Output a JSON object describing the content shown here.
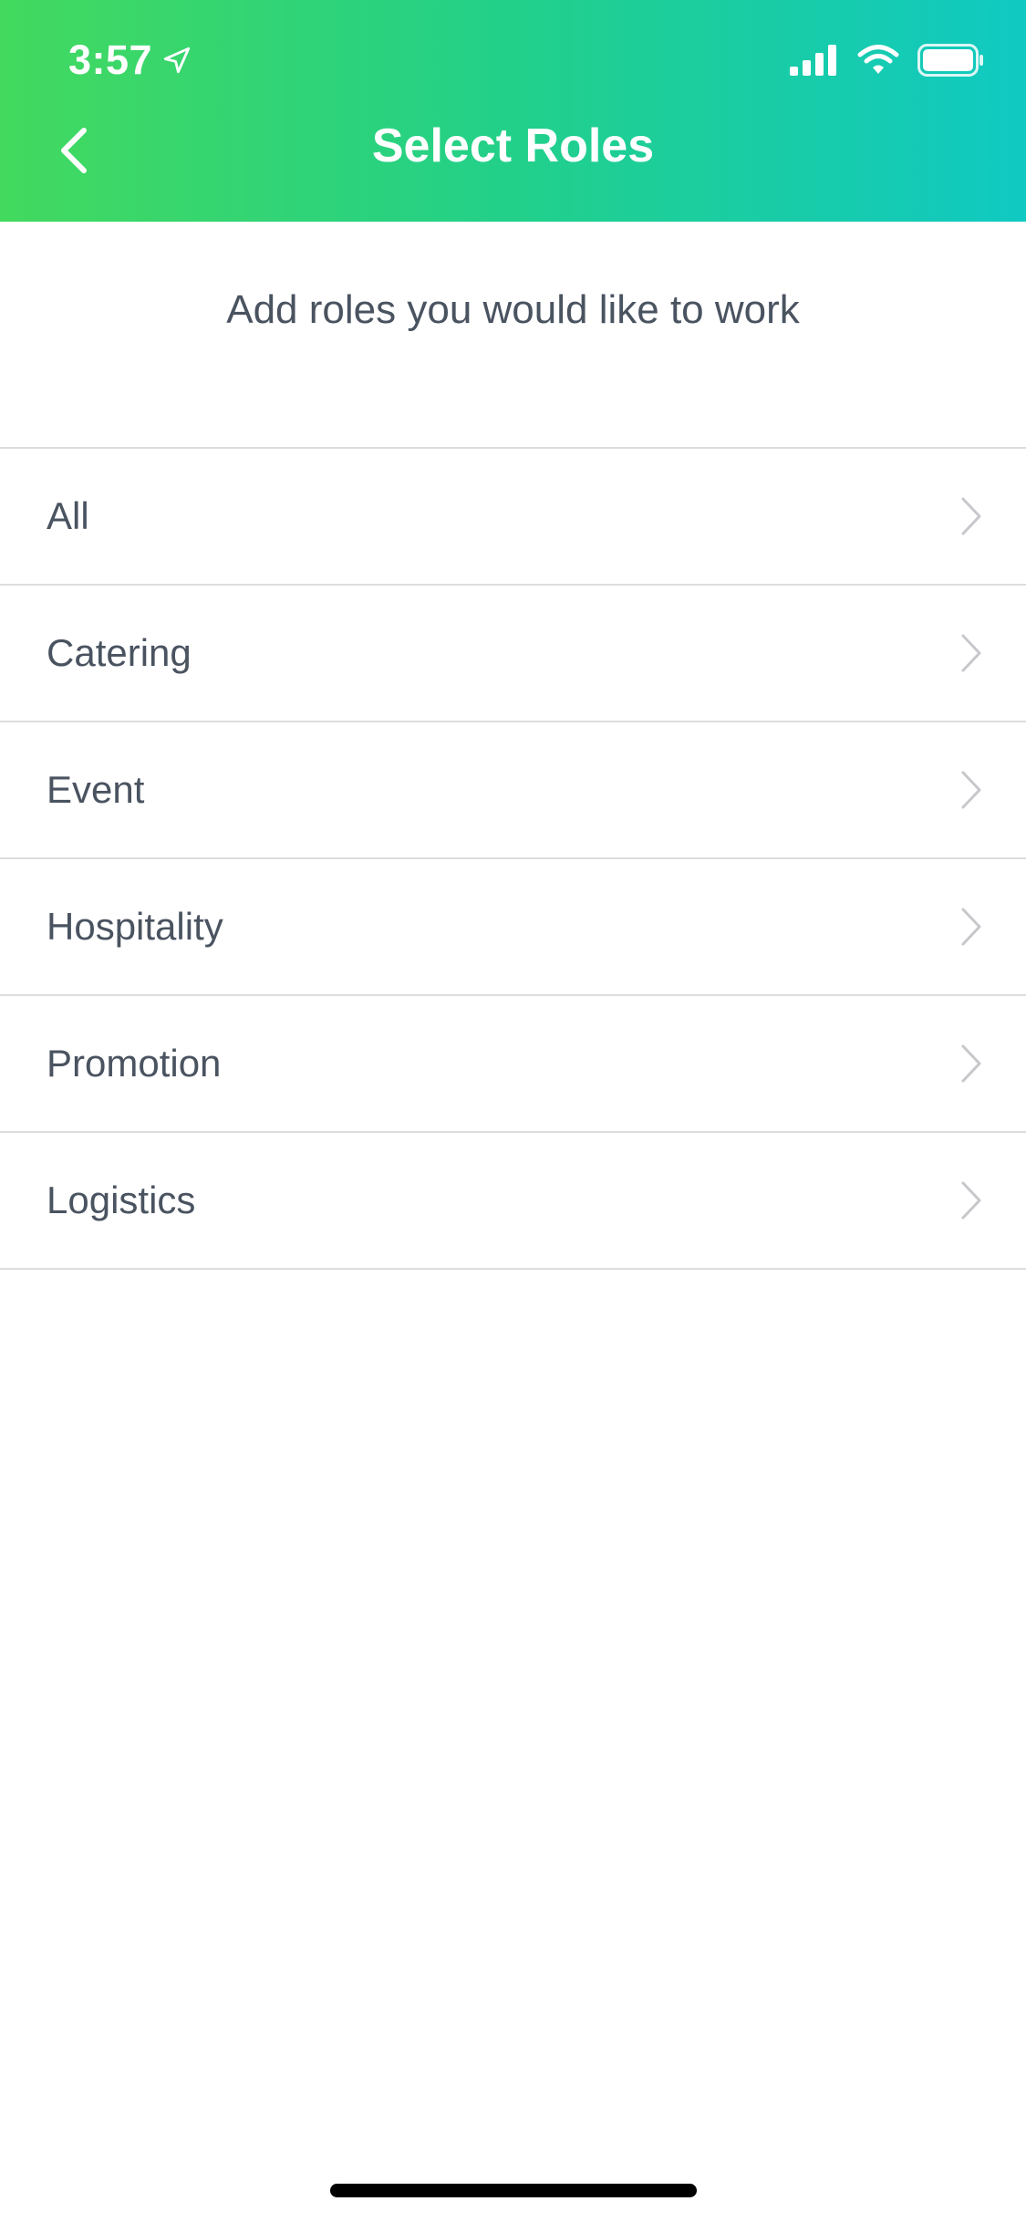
{
  "status_bar": {
    "time": "3:57"
  },
  "nav": {
    "title": "Select Roles",
    "back_icon": "chevron-left-icon"
  },
  "subtitle": "Add roles you would like to work",
  "roles": [
    {
      "label": "All"
    },
    {
      "label": "Catering"
    },
    {
      "label": "Event"
    },
    {
      "label": "Hospitality"
    },
    {
      "label": "Promotion"
    },
    {
      "label": "Logistics"
    }
  ],
  "colors": {
    "header_gradient_start": "#43d95e",
    "header_gradient_end": "#10c9c2",
    "text": "#4a5360",
    "divider": "#dddddd"
  }
}
